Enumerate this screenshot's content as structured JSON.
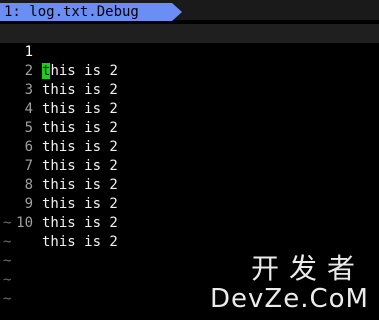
{
  "tabline": {
    "tab_label": "1: log.txt.Debug"
  },
  "editor": {
    "lines": [
      {
        "num": "1",
        "text_first": "t",
        "text_rest": "his is 2"
      },
      {
        "num": "2",
        "text": "this is 2"
      },
      {
        "num": "3",
        "text": "this is 2"
      },
      {
        "num": "4",
        "text": "this is 2"
      },
      {
        "num": "5",
        "text": "this is 2"
      },
      {
        "num": "6",
        "text": "this is 2"
      },
      {
        "num": "7",
        "text": "this is 2"
      },
      {
        "num": "8",
        "text": "this is 2"
      },
      {
        "num": "9",
        "text": "this is 2"
      },
      {
        "num": "10",
        "text": "this is 2"
      }
    ],
    "empty_marker": "~"
  },
  "watermark": {
    "cn": "开发者",
    "en": "DevZe.CoM"
  },
  "colors": {
    "tab_bg": "#6b8ef5",
    "cursor_bg": "#19d01a",
    "background": "#000000"
  }
}
